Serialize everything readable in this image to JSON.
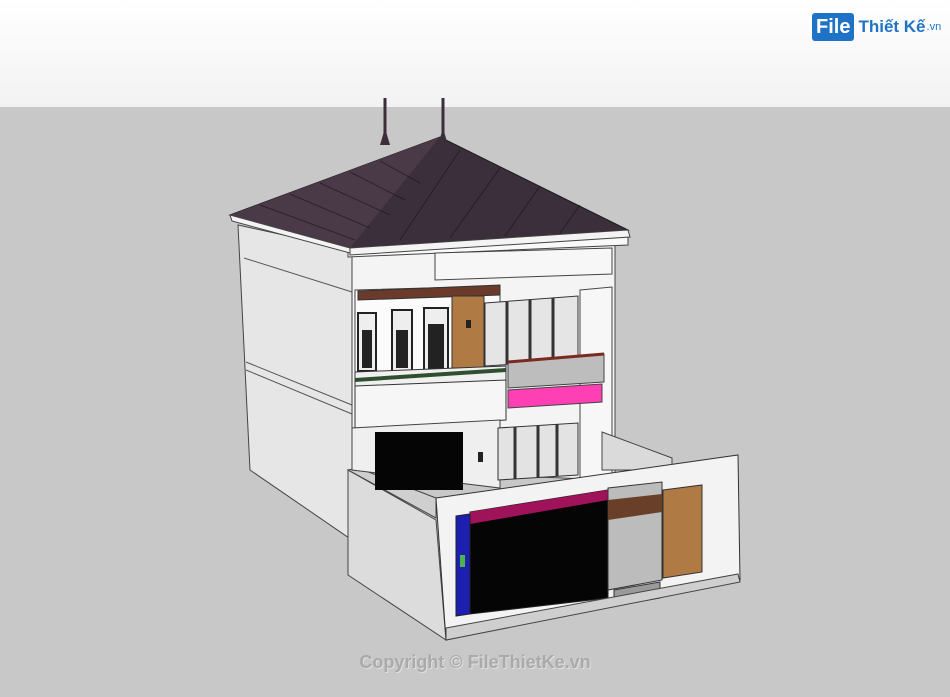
{
  "logo": {
    "mark": "File",
    "name": "Thiết Kế",
    "tld": ".vn"
  },
  "watermark": "Copyright © FileThietKe.vn",
  "icons": [
    "house-model-icon"
  ],
  "colors": {
    "sky": "#f6f6f6",
    "ground": "#c8c8c8",
    "roof": "#3a2f3a",
    "walls": "#f2f2f2",
    "accent_pink": "#ff3fb4",
    "accent_magenta": "#a0135a",
    "accent_blue": "#1c1fb0",
    "wood": "#b07a45",
    "logo_blue": "#1f73c7"
  }
}
